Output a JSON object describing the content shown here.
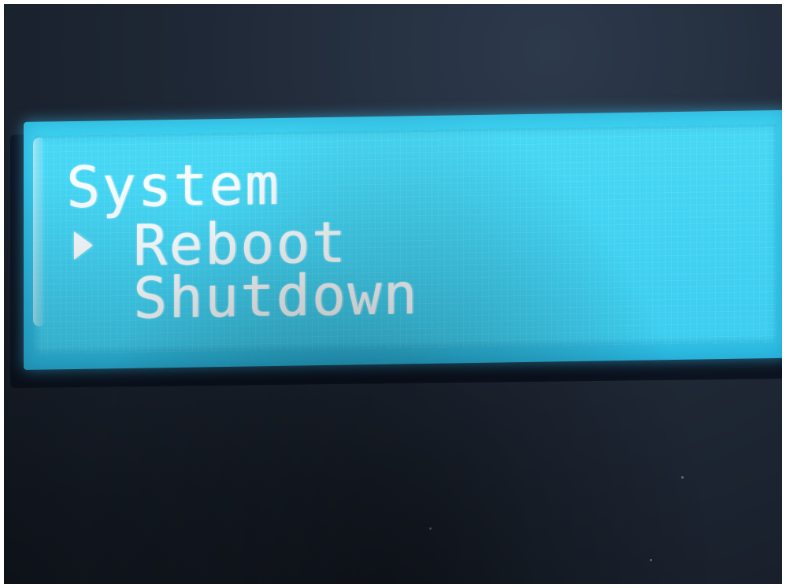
{
  "device": {
    "screen": {
      "title": "System",
      "menu_items": [
        {
          "label": "Reboot",
          "selected": true
        },
        {
          "label": "Shutdown",
          "selected": false
        }
      ],
      "cursor_icon": "triangle-right-icon"
    }
  },
  "colors": {
    "backlight": "#3fd4f3",
    "text": "#f6fcff",
    "enclosure": "#1f2836"
  }
}
